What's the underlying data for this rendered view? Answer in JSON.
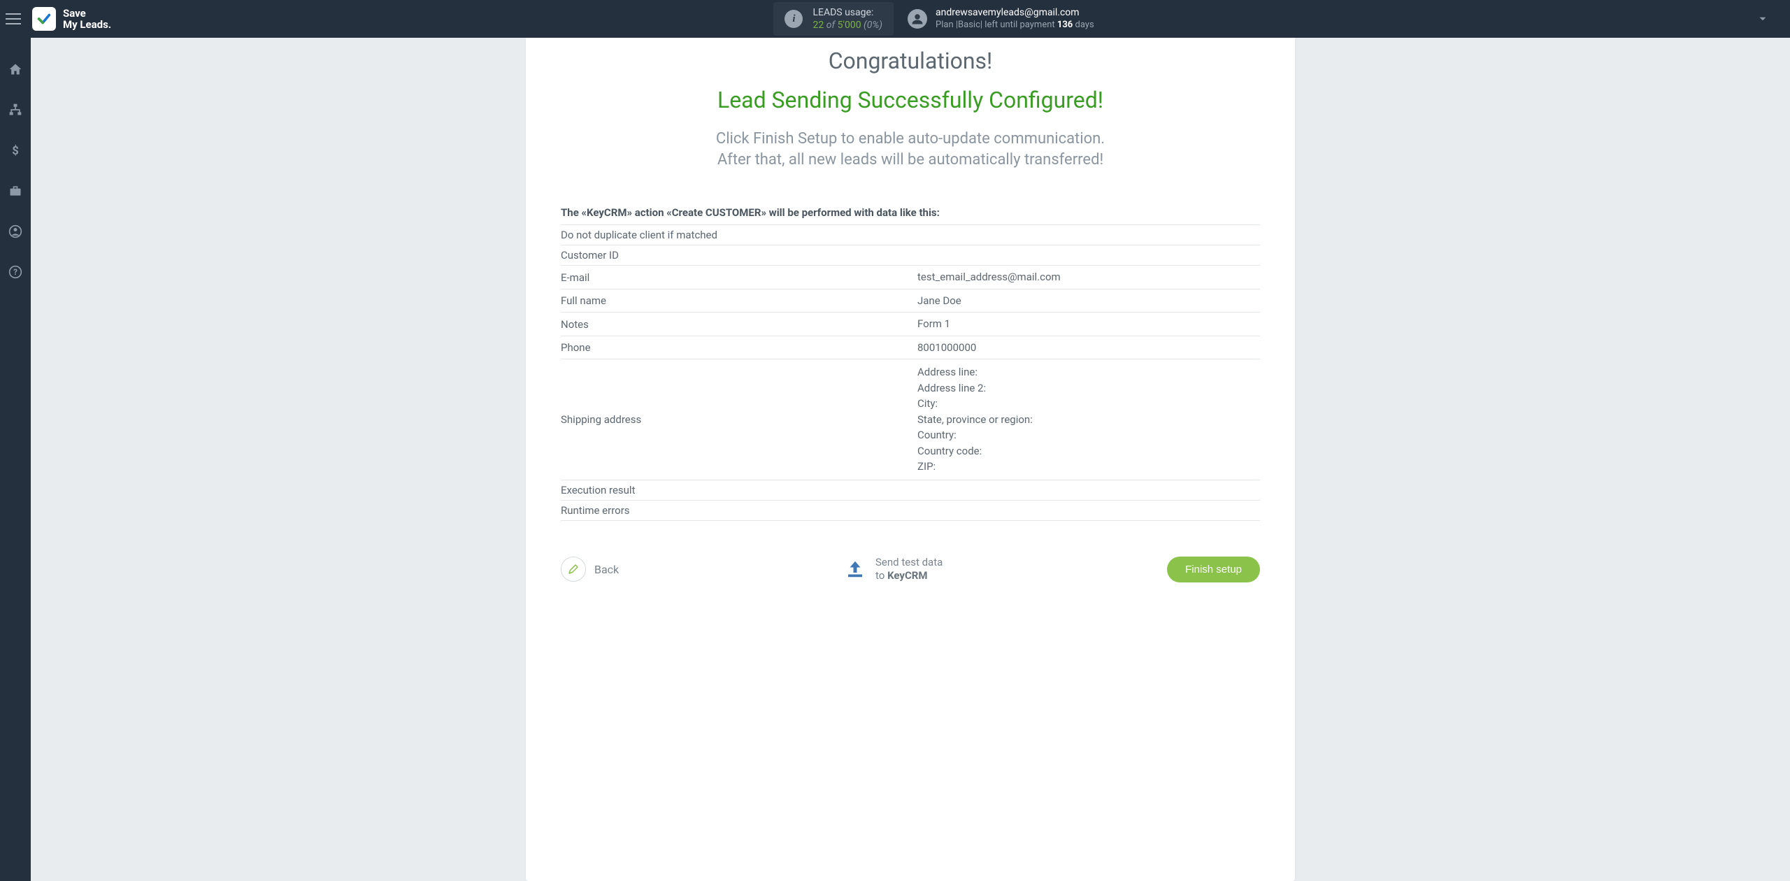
{
  "brand": {
    "line1": "Save",
    "line2": "My Leads."
  },
  "leads_usage": {
    "label": "LEADS usage:",
    "used": "22",
    "of_word": "of",
    "total": "5'000",
    "percent": "(0%)"
  },
  "user": {
    "email": "andrewsavemyleads@gmail.com",
    "plan_prefix": "Plan |",
    "plan_name": "Basic",
    "plan_suffix": "| left until payment",
    "days_num": "136",
    "days_word": "days"
  },
  "content": {
    "congrats": "Congratulations!",
    "success": "Lead Sending Successfully Configured!",
    "sub1": "Click Finish Setup to enable auto-update communication.",
    "sub2": "After that, all new leads will be automatically transferred!",
    "action_desc": "The «KeyCRM» action «Create CUSTOMER» will be performed with data like this:",
    "rows": [
      {
        "label": "Do not duplicate client if matched",
        "value": ""
      },
      {
        "label": "Customer ID",
        "value": ""
      },
      {
        "label": "E-mail",
        "value": "test_email_address@mail.com"
      },
      {
        "label": "Full name",
        "value": "Jane Doe"
      },
      {
        "label": "Notes",
        "value": "Form 1"
      },
      {
        "label": "Phone",
        "value": "8001000000"
      },
      {
        "label": "Shipping address",
        "value": "Address line:\nAddress line 2:\nCity:\nState, province or region:\nCountry:\nCountry code:\nZIP:"
      },
      {
        "label": "Execution result",
        "value": ""
      },
      {
        "label": "Runtime errors",
        "value": ""
      }
    ]
  },
  "footer": {
    "back": "Back",
    "send_line1": "Send test data",
    "send_line2_prefix": "to ",
    "send_line2_bold": "KeyCRM",
    "finish": "Finish setup"
  }
}
